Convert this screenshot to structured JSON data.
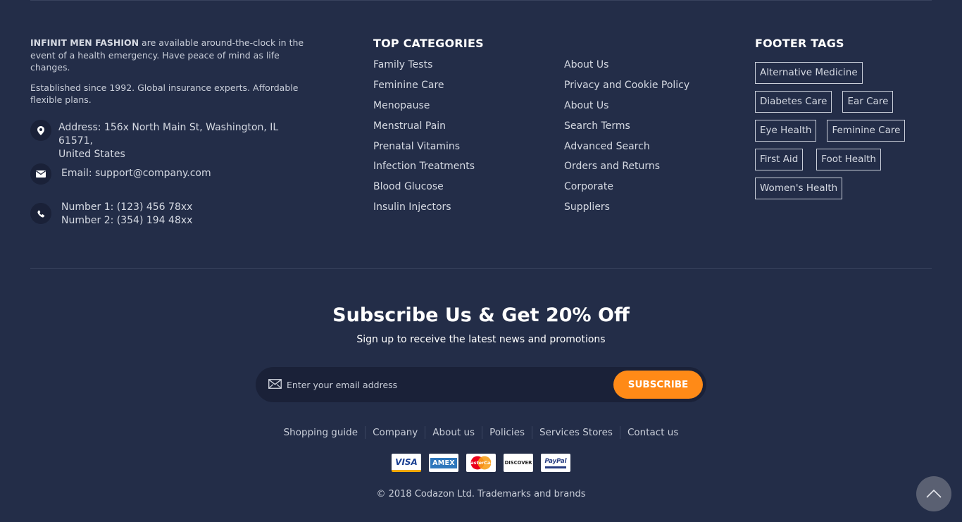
{
  "about": {
    "brand": "INFINIT MEN FASHION",
    "intro_rest": " are available around-the-clock in the event of a health emergency. Have peace of mind as life changes.",
    "established": "Established since 1992. Global insurance experts. Affordable flexible plans."
  },
  "contact": {
    "address_line1": "Address: 156x North Main St, Washington, IL 61571,",
    "address_line2": "United States",
    "email": "Email: support@company.com",
    "phone1": "Number 1: (123) 456 78xx",
    "phone2": "Number 2: (354) 194 48xx",
    "icons": [
      "map-pin-icon",
      "envelope-icon",
      "phone-icon"
    ]
  },
  "categories": {
    "title": "TOP CATEGORIES",
    "col1": [
      "Family Tests",
      "Feminine Care",
      "Menopause",
      "Menstrual Pain",
      "Prenatal Vitamins",
      "Infection Treatments",
      "Blood Glucose",
      "Insulin Injectors"
    ],
    "col2": [
      "About Us",
      "Privacy and Cookie Policy",
      "About Us",
      "Search Terms",
      "Advanced Search",
      "Orders and Returns",
      "Corporate",
      "Suppliers"
    ]
  },
  "tags": {
    "title": "FOOTER TAGS",
    "rows": [
      [
        "Alternative Medicine"
      ],
      [
        "Diabetes Care",
        "Ear Care"
      ],
      [
        "Eye Health",
        "Feminine Care"
      ],
      [
        "First Aid",
        "Foot Health"
      ],
      [
        "Women's Health"
      ]
    ]
  },
  "subscribe": {
    "title": "Subscribe Us & Get 20% Off",
    "subtitle": "Sign up to receive the latest news and promotions",
    "placeholder": "Enter your email address",
    "button": "SUBSCRIBE",
    "accent": "#ff8a17"
  },
  "bottom_links": [
    "Shopping guide",
    "Company",
    "About us",
    "Policies",
    "Services Stores",
    "Contact us"
  ],
  "payments": [
    "VISA",
    "AMEX",
    "MasterCard",
    "DISCOVER",
    "PayPal"
  ],
  "copyright": "© 2018 Codazon Ltd. Trademarks and brands",
  "colors": {
    "background": "#232d48",
    "panel": "#1a2138",
    "text": "#c9ced9"
  }
}
